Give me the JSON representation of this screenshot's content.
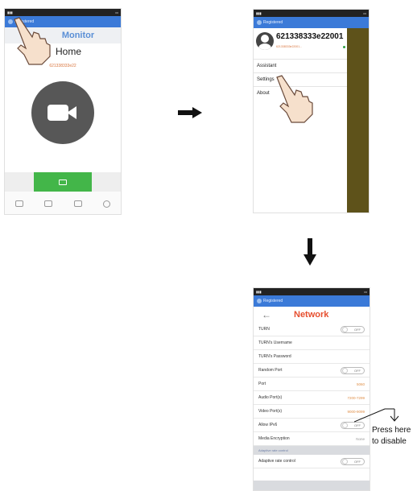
{
  "screen1": {
    "registered": "Registered",
    "title": "Monitor",
    "home": "Home",
    "device_id": "621338333e22",
    "tab_icons": [
      "megaphone-icon",
      "phone-icon",
      "phone-missed-icon",
      "settings-icon"
    ]
  },
  "screen2": {
    "registered": "Registered",
    "profile_name": "621338333e22001",
    "profile_sub": "621338333e22001...",
    "menu": [
      "Assistant",
      "Settings",
      "About"
    ]
  },
  "screen3": {
    "registered": "Registered",
    "title": "Network",
    "rows": [
      {
        "label": "TURN",
        "type": "toggle",
        "value": "OFF"
      },
      {
        "label": "TURN's Username",
        "type": "text",
        "value": ""
      },
      {
        "label": "TURN's Password",
        "type": "text",
        "value": ""
      },
      {
        "label": "Random Port",
        "type": "toggle",
        "value": "OFF"
      },
      {
        "label": "Port",
        "type": "text",
        "value": "5060"
      },
      {
        "label": "Audio Port(s)",
        "type": "text",
        "value": "7200-7299"
      },
      {
        "label": "Video Port(s)",
        "type": "text",
        "value": "9000-9099"
      },
      {
        "label": "Allow IPv6",
        "type": "toggle",
        "value": "OFF"
      },
      {
        "label": "Media Encryption",
        "type": "select",
        "value": "None"
      }
    ],
    "section": "Adaptive rate control",
    "adaptive_row": {
      "label": "Adaptive rate control",
      "value": "OFF"
    }
  },
  "callout": {
    "line1": "Press here",
    "line2": "to disable"
  },
  "colors": {
    "accent_blue": "#3b7ad8",
    "green": "#43b649",
    "title_red": "#e64f2f",
    "value_orange": "#e0904a"
  }
}
